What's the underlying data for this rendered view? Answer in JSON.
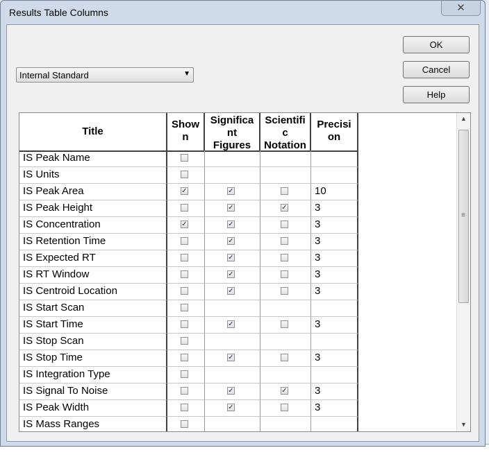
{
  "dialog": {
    "title": "Results Table Columns",
    "close_glyph": "✕",
    "dropdown": {
      "value": "Internal Standard",
      "arrow": "▼"
    },
    "buttons": {
      "ok": "OK",
      "cancel": "Cancel",
      "help": "Help"
    }
  },
  "table": {
    "headers": {
      "title": [
        "Title"
      ],
      "shown": [
        "Show",
        "n"
      ],
      "sig": [
        "Significa",
        "nt",
        "Figures"
      ],
      "sci": [
        "Scientifi",
        "c",
        "Notation"
      ],
      "prec": [
        "Precisi",
        "on"
      ]
    },
    "rows": [
      {
        "title": "IS Peak Name",
        "shown": false,
        "sig": null,
        "sci": null,
        "prec": ""
      },
      {
        "title": "IS Units",
        "shown": false,
        "sig": null,
        "sci": null,
        "prec": ""
      },
      {
        "title": "IS Peak Area",
        "shown": true,
        "sig": true,
        "sci": false,
        "prec": "10"
      },
      {
        "title": "IS Peak Height",
        "shown": false,
        "sig": true,
        "sci": true,
        "prec": "3"
      },
      {
        "title": "IS Concentration",
        "shown": true,
        "sig": true,
        "sci": false,
        "prec": "3"
      },
      {
        "title": "IS Retention Time",
        "shown": false,
        "sig": true,
        "sci": false,
        "prec": "3"
      },
      {
        "title": "IS Expected RT",
        "shown": false,
        "sig": true,
        "sci": false,
        "prec": "3"
      },
      {
        "title": "IS RT Window",
        "shown": false,
        "sig": true,
        "sci": false,
        "prec": "3"
      },
      {
        "title": "IS Centroid Location",
        "shown": false,
        "sig": true,
        "sci": false,
        "prec": "3"
      },
      {
        "title": "IS Start Scan",
        "shown": false,
        "sig": null,
        "sci": null,
        "prec": ""
      },
      {
        "title": "IS Start Time",
        "shown": false,
        "sig": true,
        "sci": false,
        "prec": "3"
      },
      {
        "title": "IS Stop Scan",
        "shown": false,
        "sig": null,
        "sci": null,
        "prec": ""
      },
      {
        "title": "IS Stop Time",
        "shown": false,
        "sig": true,
        "sci": false,
        "prec": "3"
      },
      {
        "title": "IS Integration Type",
        "shown": false,
        "sig": null,
        "sci": null,
        "prec": ""
      },
      {
        "title": "IS Signal To Noise",
        "shown": false,
        "sig": true,
        "sci": true,
        "prec": "3"
      },
      {
        "title": "IS Peak Width",
        "shown": false,
        "sig": true,
        "sci": false,
        "prec": "3"
      },
      {
        "title": "IS Mass Ranges",
        "shown": false,
        "sig": null,
        "sci": null,
        "prec": ""
      }
    ]
  },
  "scrollbar": {
    "up": "▲",
    "down": "▼",
    "grip": "≡"
  },
  "icons": {
    "close": "close-icon",
    "dropdown": "chevron-down-icon",
    "check": "check-icon"
  },
  "colors": {
    "title_bar": "#cfdbea",
    "client": "#f0f0f0",
    "grid_bg": "#ffffff"
  }
}
